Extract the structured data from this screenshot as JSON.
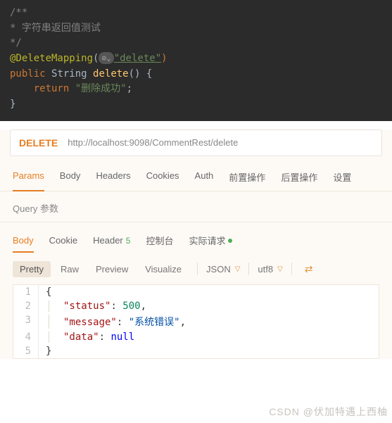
{
  "code": {
    "comment1": "/**",
    "comment2": " * 字符串返回值测试",
    "comment3": " */",
    "annotation": "@DeleteMapping",
    "ann_arg": "\"delete\"",
    "kw_public": "public",
    "type_string": "String",
    "method_name": "delete",
    "brace_open": "{",
    "kw_return": "return",
    "ret_val": "\"删除成功\"",
    "brace_close": "}"
  },
  "request": {
    "method": "DELETE",
    "url": "http://localhost:9098/CommentRest/delete"
  },
  "tabs": [
    "Params",
    "Body",
    "Headers",
    "Cookies",
    "Auth",
    "前置操作",
    "后置操作",
    "设置"
  ],
  "section_label": "Query 参数",
  "resp_tabs": {
    "body": "Body",
    "cookie": "Cookie",
    "header": "Header",
    "header_count": "5",
    "console": "控制台",
    "actual": "实际请求"
  },
  "toolbar": {
    "pretty": "Pretty",
    "raw": "Raw",
    "preview": "Preview",
    "visualize": "Visualize",
    "fmt": "JSON",
    "enc": "utf8"
  },
  "response_json": {
    "lines": [
      {
        "n": "1",
        "html": "<span class='jp'>{</span>"
      },
      {
        "n": "2",
        "html": "<span class='guide'><span class='jk'>\"status\"</span><span class='jp'>: </span><span class='jn'>500</span><span class='jp'>,</span></span>"
      },
      {
        "n": "3",
        "html": "<span class='guide'><span class='jk'>\"message\"</span><span class='jp'>: </span><span class='js'>\"系统错误\"</span><span class='jp'>,</span></span>"
      },
      {
        "n": "4",
        "html": "<span class='guide'><span class='jk'>\"data\"</span><span class='jp'>: </span><span class='jl'>null</span></span>"
      },
      {
        "n": "5",
        "html": "<span class='jp'>}</span>"
      }
    ]
  },
  "watermark": "CSDN @伏加特遇上西柚"
}
